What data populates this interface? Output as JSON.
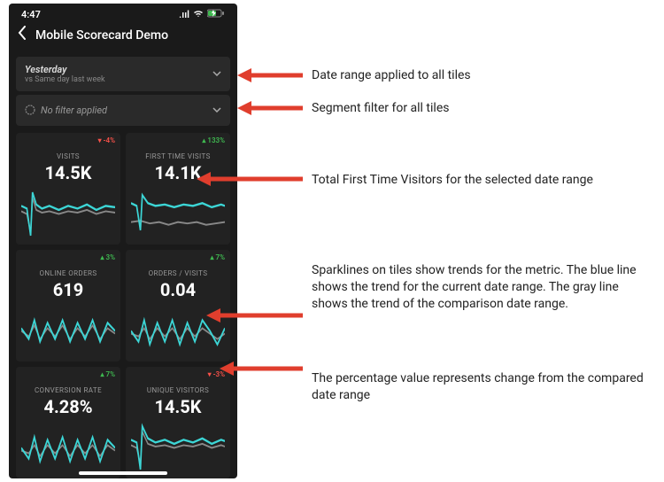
{
  "status": {
    "time": "4:47",
    "signal": "▮▮▮",
    "wifi": "⧉",
    "battery": "⚡"
  },
  "header": {
    "title": "Mobile Scorecard Demo"
  },
  "dateRange": {
    "label": "Yesterday",
    "sub": "vs Same day last week"
  },
  "filter": {
    "label": "No filter applied"
  },
  "tiles": [
    {
      "label": "VISITS",
      "value": "14.5K",
      "delta": "-4%",
      "dir": "down"
    },
    {
      "label": "FIRST TIME VISITS",
      "value": "14.1K",
      "delta": "133%",
      "dir": "up"
    },
    {
      "label": "ONLINE ORDERS",
      "value": "619",
      "delta": "3%",
      "dir": "up"
    },
    {
      "label": "ORDERS / VISITS",
      "value": "0.04",
      "delta": "7%",
      "dir": "up"
    },
    {
      "label": "CONVERSION RATE",
      "value": "4.28%",
      "delta": "7%",
      "dir": "up"
    },
    {
      "label": "UNIQUE VISITORS",
      "value": "14.5K",
      "delta": "-3%",
      "dir": "down"
    }
  ],
  "annotations": {
    "a1": "Date range applied to all tiles",
    "a2": "Segment filter for all tiles",
    "a3": "Total First Time Visitors for the selected date range",
    "a4": "Sparklines on tiles show trends for the metric. The blue line shows the trend for the current date range. The gray line shows the trend of the comparison date range.",
    "a5": "The percentage value represents change from the compared date range"
  }
}
